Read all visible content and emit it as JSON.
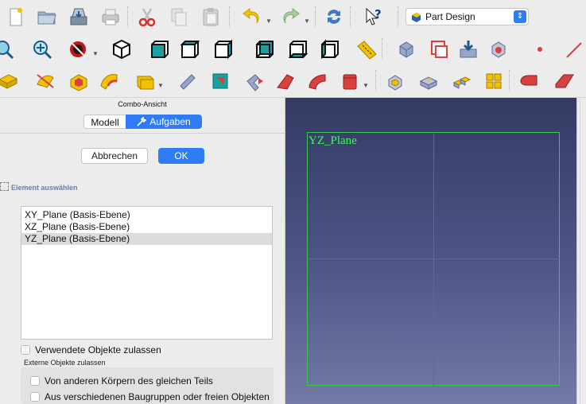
{
  "toolbar": {
    "workbench_selector": {
      "label": "Part Design"
    },
    "row1_icons": [
      "new-document-icon",
      "open-folder-icon",
      "save-icon",
      "print-icon",
      "cut-icon",
      "copy-icon",
      "paste-icon",
      "undo-icon",
      "redo-icon",
      "refresh-icon",
      "whats-this-icon"
    ],
    "row2_icons": [
      "fit-selection-icon",
      "zoom-icon",
      "draw-style-icon",
      "view-isometric-icon",
      "view-front-icon",
      "view-top-icon",
      "view-right-icon",
      "view-rear-icon",
      "view-bottom-icon",
      "view-left-icon",
      "measure-icon",
      "part-icon",
      "sketch-icon",
      "import-icon",
      "shape-binder-icon",
      "point-icon",
      "line-icon"
    ],
    "row3_icons": [
      "pad-icon",
      "revolution-icon",
      "pocket-icon",
      "groove-icon",
      "hole-icon",
      "additive-loft-icon",
      "additive-pipe-icon",
      "subtractive-pipe-icon",
      "subtractive-loft-icon",
      "additive-primitive-icon",
      "mirrored-icon",
      "linear-pattern-icon",
      "polar-pattern-icon",
      "multi-transform-icon",
      "fillet-icon",
      "chamfer-icon"
    ],
    "colors": {
      "accent": "#2f7df6",
      "feature_yellow": "#f2c200",
      "feature_red": "#d94040",
      "view_teal": "#1aa0a0"
    }
  },
  "combo_view": {
    "title": "Combo-Ansicht",
    "tabs": {
      "model": "Modell",
      "tasks": "Aufgaben"
    },
    "cancel_label": "Abbrechen",
    "ok_label": "OK",
    "select_element_label": "Element auswählen",
    "planes": [
      {
        "label": "XY_Plane (Basis-Ebene)",
        "selected": false
      },
      {
        "label": "XZ_Plane (Basis-Ebene)",
        "selected": false
      },
      {
        "label": "YZ_Plane (Basis-Ebene)",
        "selected": true
      }
    ],
    "allow_used_label": "Verwendete Objekte zulassen",
    "external_label": "Externe Objekte zulassen",
    "other_bodies_label": "Von anderen Körpern des gleichen Teils",
    "other_assemblies_label": "Aus verschiedenen Baugruppen oder freien Objekten"
  },
  "viewport": {
    "plane_label": "YZ_Plane",
    "colors": {
      "plane_border": "#33cc44",
      "axis": "#3a6fd6",
      "background_top": "#333a63",
      "background_bottom": "#7479a6"
    }
  }
}
